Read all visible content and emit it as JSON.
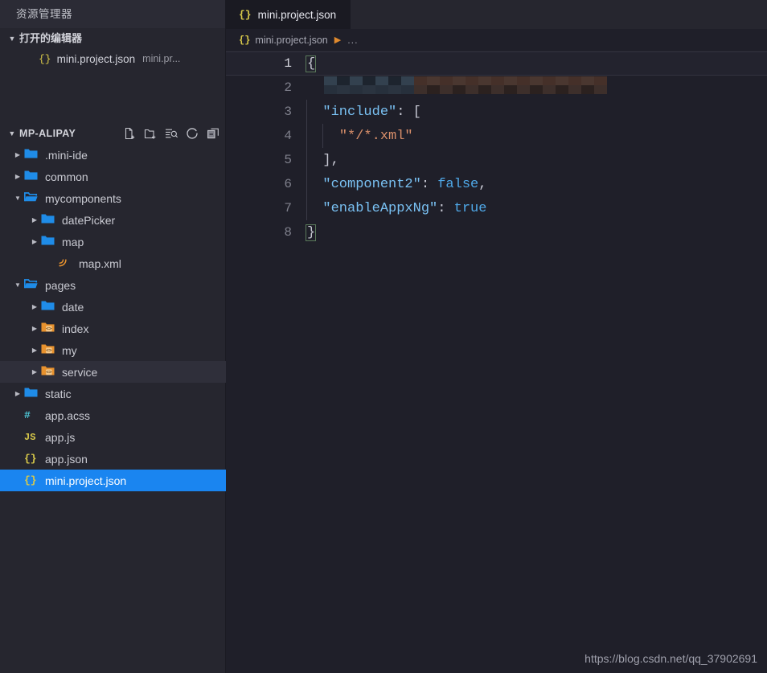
{
  "sidebar": {
    "title": "资源管理器",
    "open_editors": {
      "label": "打开的编辑器",
      "twisty": "▼",
      "items": [
        {
          "icon": "json-braces-icon",
          "icon_glyph": "{}",
          "name": "mini.project.json",
          "sub": "mini.pr..."
        }
      ]
    },
    "project": {
      "label": "MP-ALIPAY",
      "twisty": "▼",
      "actions": [
        {
          "name": "new-file-icon",
          "title": "新建文件"
        },
        {
          "name": "new-folder-icon",
          "title": "新建文件夹"
        },
        {
          "name": "search-in-folder-icon",
          "title": "在文件夹中查找"
        },
        {
          "name": "refresh-icon",
          "title": "刷新"
        },
        {
          "name": "collapse-all-icon",
          "title": "全部折叠"
        }
      ]
    },
    "tree": [
      {
        "name": ".mini-ide",
        "depth": 1,
        "type": "folder",
        "expanded": false,
        "arrow": "▶",
        "state": "normal"
      },
      {
        "name": "common",
        "depth": 1,
        "type": "folder",
        "expanded": false,
        "arrow": "▶",
        "state": "normal"
      },
      {
        "name": "mycomponents",
        "depth": 1,
        "type": "folder-open",
        "expanded": true,
        "arrow": "▼",
        "state": "normal"
      },
      {
        "name": "datePicker",
        "depth": 2,
        "type": "folder",
        "expanded": false,
        "arrow": "▶",
        "state": "normal"
      },
      {
        "name": "map",
        "depth": 2,
        "type": "folder",
        "expanded": false,
        "arrow": "▶",
        "state": "normal"
      },
      {
        "name": "map.xml",
        "depth": 3,
        "type": "xml-file",
        "expanded": false,
        "arrow": "",
        "state": "normal"
      },
      {
        "name": "pages",
        "depth": 1,
        "type": "folder-open",
        "expanded": true,
        "arrow": "▼",
        "state": "normal"
      },
      {
        "name": "date",
        "depth": 2,
        "type": "folder",
        "expanded": false,
        "arrow": "▶",
        "state": "normal"
      },
      {
        "name": "index",
        "depth": 2,
        "type": "folder-code",
        "expanded": false,
        "arrow": "▶",
        "state": "normal"
      },
      {
        "name": "my",
        "depth": 2,
        "type": "folder-code",
        "expanded": false,
        "arrow": "▶",
        "state": "normal"
      },
      {
        "name": "service",
        "depth": 2,
        "type": "folder-code",
        "expanded": false,
        "arrow": "▶",
        "state": "hover"
      },
      {
        "name": "static",
        "depth": 1,
        "type": "folder",
        "expanded": false,
        "arrow": "▶",
        "state": "normal"
      },
      {
        "name": "app.acss",
        "depth": 1,
        "type": "acss-file",
        "expanded": false,
        "arrow": "",
        "state": "normal"
      },
      {
        "name": "app.js",
        "depth": 1,
        "type": "js-file",
        "expanded": false,
        "arrow": "",
        "state": "normal"
      },
      {
        "name": "app.json",
        "depth": 1,
        "type": "json-file",
        "expanded": false,
        "arrow": "",
        "state": "normal"
      },
      {
        "name": "mini.project.json",
        "depth": 1,
        "type": "json-file",
        "expanded": false,
        "arrow": "",
        "state": "selected"
      }
    ]
  },
  "editor": {
    "tabs": [
      {
        "icon_glyph": "{}",
        "label": "mini.project.json",
        "active": true
      }
    ],
    "breadcrumb": {
      "icon_glyph": "{}",
      "file": "mini.project.json",
      "separator": "▶",
      "tail": "..."
    },
    "lines": [
      {
        "no": "1",
        "active": true,
        "redacted": false,
        "tokens": [
          {
            "t": "{",
            "c": "p brace-match"
          }
        ]
      },
      {
        "no": "2",
        "active": false,
        "redacted": true,
        "tokens": []
      },
      {
        "no": "3",
        "active": false,
        "redacted": false,
        "tokens": [
          {
            "t": "  ",
            "c": "p"
          },
          {
            "t": "\"include\"",
            "c": "k"
          },
          {
            "t": ": [",
            "c": "p"
          }
        ]
      },
      {
        "no": "4",
        "active": false,
        "redacted": false,
        "tokens": [
          {
            "t": "    ",
            "c": "p"
          },
          {
            "t": "\"*/*.xml\"",
            "c": "s"
          }
        ]
      },
      {
        "no": "5",
        "active": false,
        "redacted": false,
        "tokens": [
          {
            "t": "  ],",
            "c": "p"
          }
        ]
      },
      {
        "no": "6",
        "active": false,
        "redacted": false,
        "tokens": [
          {
            "t": "  ",
            "c": "p"
          },
          {
            "t": "\"component2\"",
            "c": "k"
          },
          {
            "t": ": ",
            "c": "p"
          },
          {
            "t": "false",
            "c": "b"
          },
          {
            "t": ",",
            "c": "p"
          }
        ]
      },
      {
        "no": "7",
        "active": false,
        "redacted": false,
        "tokens": [
          {
            "t": "  ",
            "c": "p"
          },
          {
            "t": "\"enableAppxNg\"",
            "c": "k"
          },
          {
            "t": ": ",
            "c": "p"
          },
          {
            "t": "true",
            "c": "b"
          }
        ]
      },
      {
        "no": "8",
        "active": false,
        "redacted": false,
        "tokens": [
          {
            "t": "}",
            "c": "p brace-match"
          }
        ]
      }
    ]
  },
  "watermark": "https://blog.csdn.net/qq_37902691",
  "colors": {
    "sidebar_bg": "#26262f",
    "editor_bg": "#1f1f29",
    "tab_active_bg": "#1a1a22",
    "selection_blue": "#1a85f0",
    "folder_blue": "#1f8ce8",
    "folder_orange": "#e8922e",
    "json_yellow": "#d8c94a",
    "js_yellow": "#d8c94a",
    "acss_cyan": "#4ec9d8",
    "string_orange": "#d98f6a",
    "key_blue": "#79c0f2",
    "bool_blue": "#4fa8e8",
    "breadcrumb_arrow": "#e08a2e"
  }
}
